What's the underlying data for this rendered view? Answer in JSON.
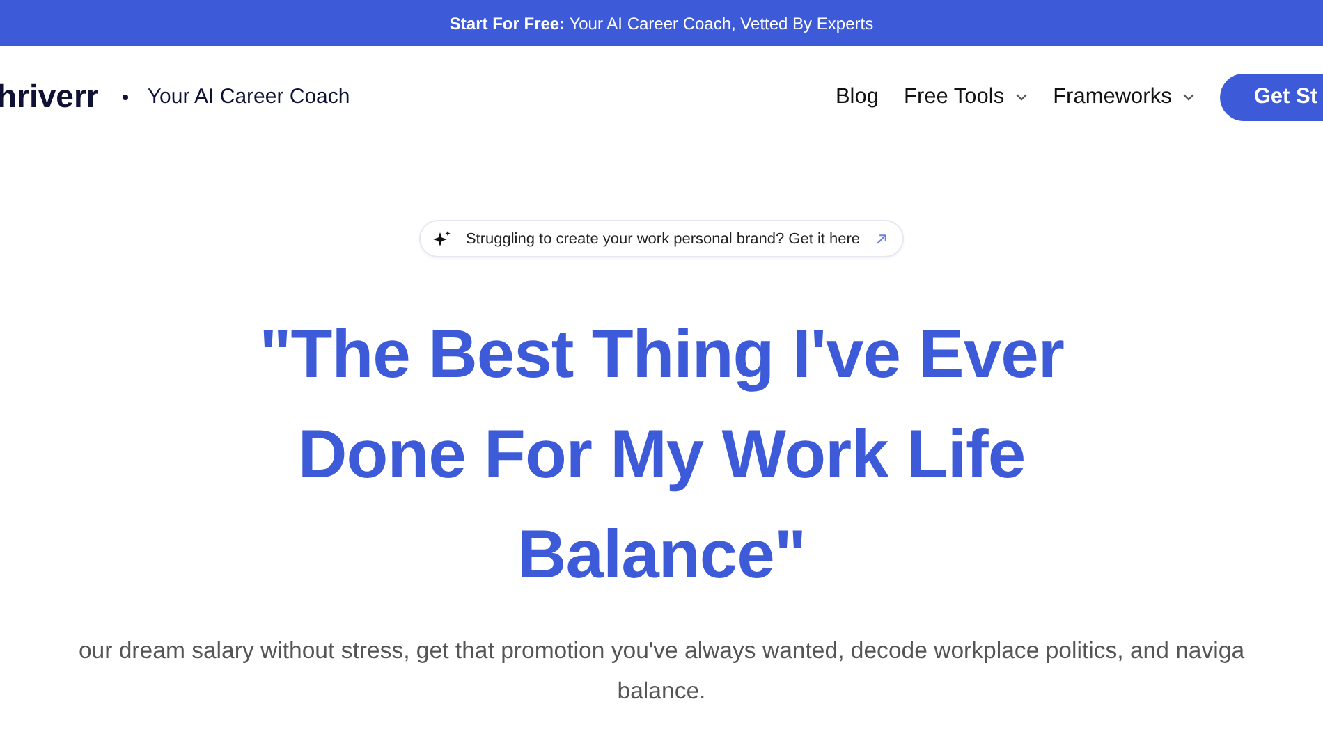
{
  "banner": {
    "text": "**Start For Free:** Your AI Career Coach, Vetted By Experts"
  },
  "header": {
    "logo": "hriverr",
    "tagline": "Your AI Career Coach",
    "nav": [
      {
        "label": "Blog",
        "dropdown": false
      },
      {
        "label": "Free Tools",
        "dropdown": true
      },
      {
        "label": "Frameworks",
        "dropdown": true
      }
    ],
    "cta": "Get St"
  },
  "hero": {
    "pill": "Struggling to create your work personal brand? Get it here",
    "headline": "\"The Best Thing I've Ever Done For My Work Life Balance\"",
    "subtitle_lines": [
      "our dream salary without stress, get that promotion you've always wanted, decode workplace politics, and naviga",
      "balance."
    ]
  }
}
